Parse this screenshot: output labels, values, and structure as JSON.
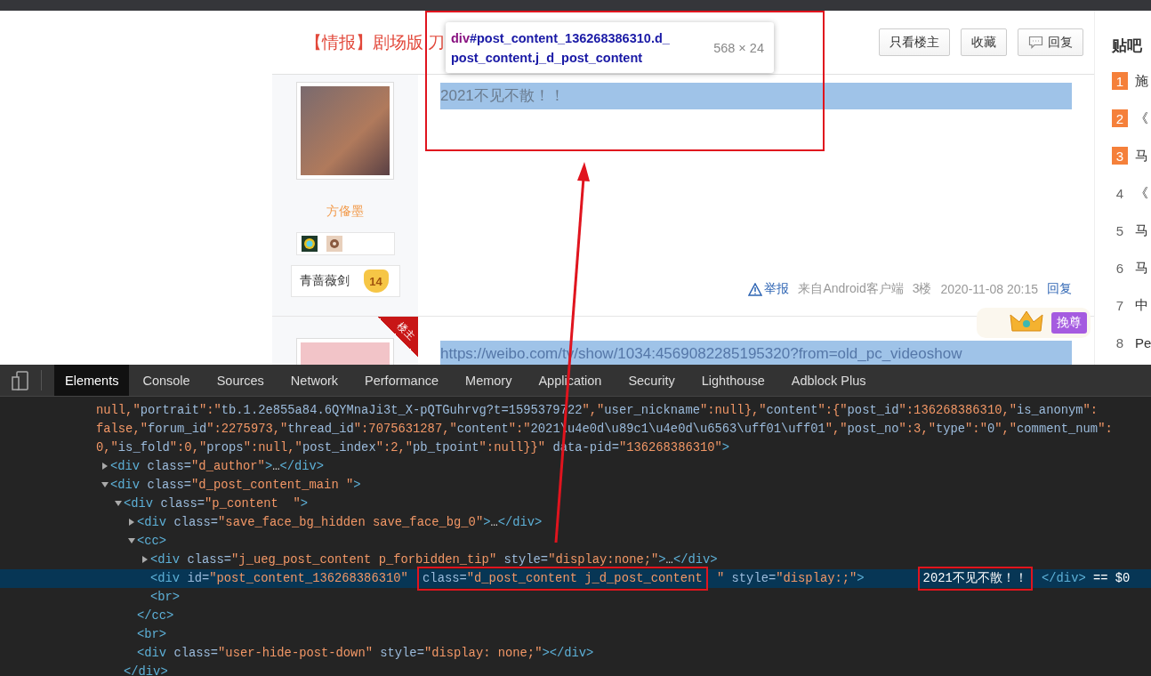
{
  "thread": {
    "title": "【情报】剧场版 刀",
    "buttons": [
      {
        "label": "只看楼主",
        "icon": false
      },
      {
        "label": "收藏",
        "icon": false
      },
      {
        "label": "回复",
        "icon": true
      }
    ],
    "posts": [
      {
        "author": "方俻墨",
        "level_title": "青蔷薇剑",
        "level": "14",
        "content": "2021不见不散！！",
        "report": "举报",
        "source": "来自Android客户端",
        "floor": "3楼",
        "time": "2020-11-08 20:15",
        "reply": "回复",
        "op": false
      },
      {
        "op_ribbon": "楼主",
        "badge": "挽尊",
        "content": "https://weibo.com/tv/show/1034:4569082285195320?from=old_pc_videoshow",
        "op": true
      }
    ]
  },
  "sidebar": {
    "heading": "贴吧",
    "items": [
      {
        "rank": "1",
        "text": "施",
        "top": true
      },
      {
        "rank": "2",
        "text": "《",
        "top": true
      },
      {
        "rank": "3",
        "text": "马",
        "top": true
      },
      {
        "rank": "4",
        "text": "《",
        "top": false
      },
      {
        "rank": "5",
        "text": "马",
        "top": false
      },
      {
        "rank": "6",
        "text": "马",
        "top": false
      },
      {
        "rank": "7",
        "text": "中",
        "top": false
      },
      {
        "rank": "8",
        "text": "Pe",
        "top": false
      }
    ]
  },
  "inspect_tooltip": {
    "tag": "div",
    "selector": "#post_content_136268386310.d_post_content.j_d_post_content",
    "size": "568 × 24"
  },
  "devtools": {
    "tabs": [
      {
        "label": "Elements",
        "selected": true
      },
      {
        "label": "Console",
        "selected": false
      },
      {
        "label": "Sources",
        "selected": false
      },
      {
        "label": "Network",
        "selected": false
      },
      {
        "label": "Performance",
        "selected": false
      },
      {
        "label": "Memory",
        "selected": false
      },
      {
        "label": "Application",
        "selected": false
      },
      {
        "label": "Security",
        "selected": false
      },
      {
        "label": "Lighthouse",
        "selected": false
      },
      {
        "label": "Adblock Plus",
        "selected": false
      }
    ],
    "dom_tree": {
      "lines": [
        "null,\"portrait\":\"tb.1.2e855a84.6QYMnaJi3t_X-pQTGuhrvg?t=1595379722\",\"user_nickname\":null},\"content\":{\"post_id\":136268386310,\"is_anonym\":",
        "false,\"forum_id\":2275973,\"thread_id\":7075631287,\"content\":\"2021\\u4e0d\\u89c1\\u4e0d\\u6563\\uff01\\uff01\",\"post_no\":3,\"type\":\"0\",\"comment_num\":",
        "0,\"is_fold\":0,\"props\":null,\"post_index\":2,\"pb_tpoint\":null}}\" data-pid=\"136268386310\">"
      ],
      "children": [
        {
          "markup": "<div class=\"d_author\">…</div>",
          "expanded": false,
          "selected": false
        },
        {
          "markup": "<div class=\"d_post_content_main \">",
          "expanded": true,
          "selected": false,
          "children": [
            {
              "markup": "<div class=\"p_content  \">",
              "expanded": true,
              "selected": false,
              "close": "</div>",
              "children": [
                {
                  "markup": "<div class=\"save_face_bg_hidden save_face_bg_0\">…</div>",
                  "expanded": false,
                  "selected": false
                },
                {
                  "markup": "<cc>",
                  "expanded": true,
                  "selected": false,
                  "close": "</cc>",
                  "children": [
                    {
                      "markup": "<div class=\"j_ueg_post_content p_forbidden_tip\" style=\"display:none;\">…</div>",
                      "expanded": false,
                      "selected": false
                    },
                    {
                      "parts": [
                        {
                          "text": "<div id=\"post_content_136268386310\" ",
                          "boxed": false
                        },
                        {
                          "text": "class=\"d_post_content j_d_post_content",
                          "boxed": true
                        },
                        {
                          "text": " \" style=\"display:;\">",
                          "boxed": false
                        },
                        {
                          "text": "2021不见不散！！",
                          "boxed": true
                        },
                        {
                          "text": " </div> == $0",
                          "boxed": false
                        }
                      ],
                      "selected": true
                    },
                    {
                      "markup": "<br>",
                      "selected": false
                    }
                  ]
                },
                {
                  "markup": "<br>",
                  "selected": false
                },
                {
                  "markup": "<div class=\"user-hide-post-down\" style=\"display: none;\"></div>",
                  "selected": false
                }
              ]
            }
          ]
        }
      ]
    }
  }
}
